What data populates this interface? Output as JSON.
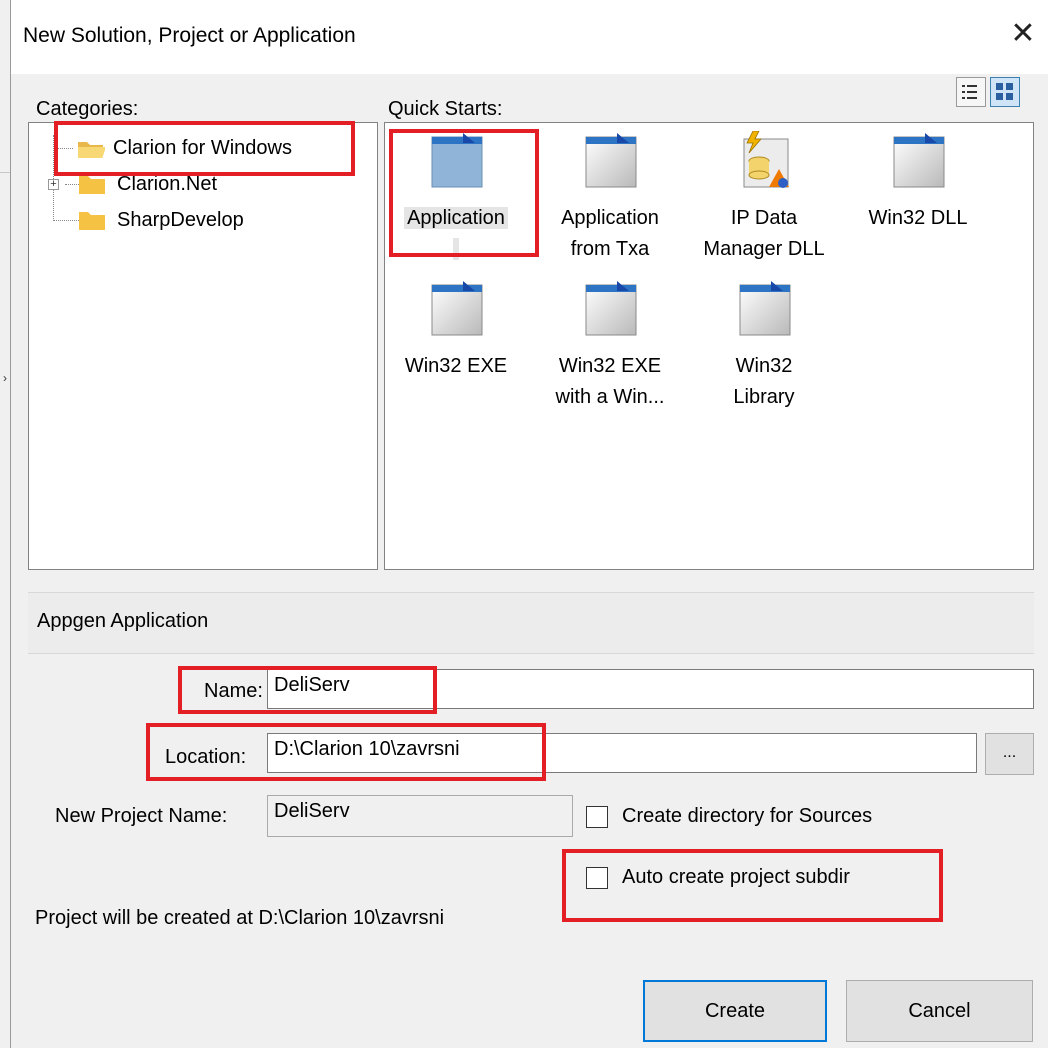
{
  "dialog": {
    "title": "New Solution, Project or Application",
    "close_glyph": "✕"
  },
  "categories": {
    "label": "Categories:",
    "items": [
      {
        "label": "Clarion for Windows",
        "icon": "folder-open-icon"
      },
      {
        "label": "Clarion.Net",
        "icon": "folder-icon"
      },
      {
        "label": "SharpDevelop",
        "icon": "folder-icon"
      }
    ]
  },
  "quick_starts": {
    "label": "Quick Starts:",
    "items": [
      {
        "line1": "Application",
        "line2": "",
        "icon": "application-icon"
      },
      {
        "line1": "Application",
        "line2": "from Txa",
        "icon": "application-icon"
      },
      {
        "line1": "IP Data",
        "line2": "Manager DLL",
        "icon": "ip-data-manager-icon"
      },
      {
        "line1": "Win32 DLL",
        "line2": "",
        "icon": "application-icon"
      },
      {
        "line1": "Win32 EXE",
        "line2": "",
        "icon": "application-icon"
      },
      {
        "line1": "Win32 EXE",
        "line2": "with a Win...",
        "icon": "application-icon"
      },
      {
        "line1": "Win32",
        "line2": "Library",
        "icon": "application-icon"
      }
    ]
  },
  "description": "Appgen Application",
  "form": {
    "name_label": "Name:",
    "name_value": "DeliServ",
    "location_label": "Location:",
    "location_value": "D:\\Clarion 10\\zavrsni",
    "browse_label": "...",
    "project_name_label": "New Project Name:",
    "project_name_value": "DeliServ",
    "create_dir_label": "Create directory for Sources",
    "auto_subdir_label": "Auto create project subdir",
    "path_info": "Project will be created at D:\\Clarion 10\\zavrsni"
  },
  "buttons": {
    "create": "Create",
    "cancel": "Cancel"
  },
  "colors": {
    "highlight": "#e31e24",
    "accent": "#0078d7"
  }
}
